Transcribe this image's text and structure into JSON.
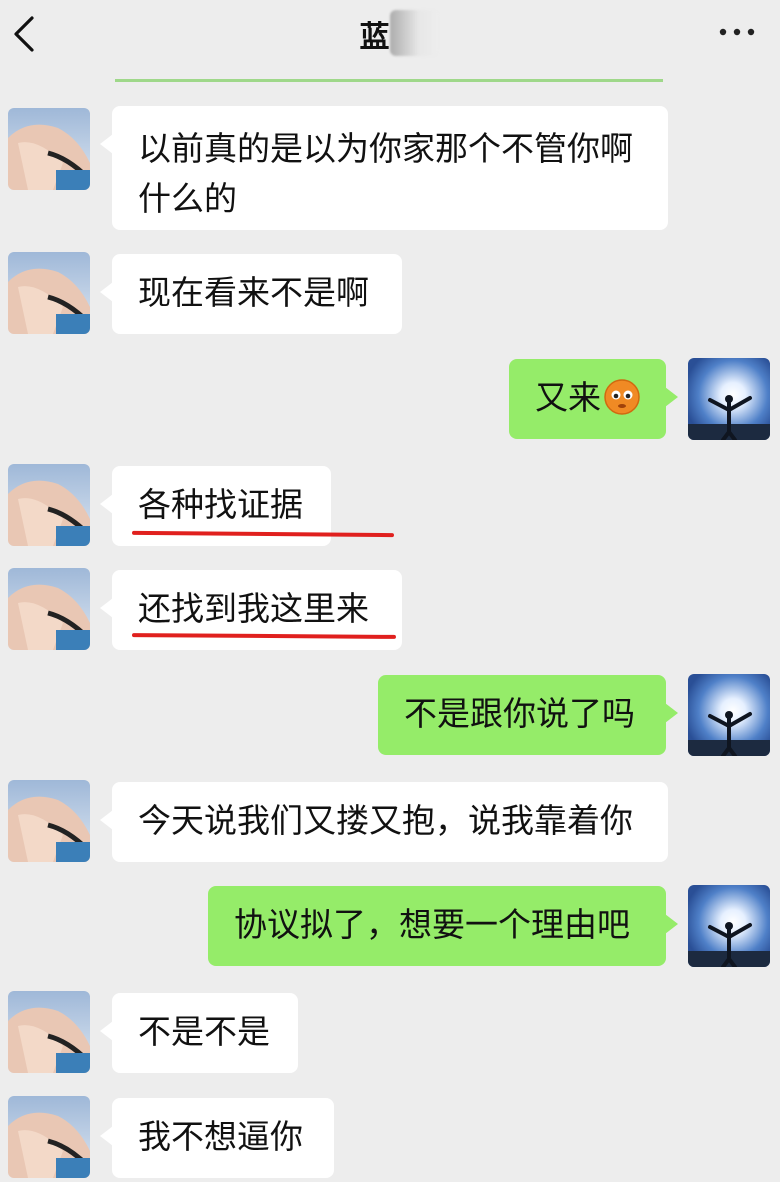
{
  "header": {
    "title": "蓝",
    "back_icon": "chevron-left-icon",
    "more_icon": "more-dots-icon"
  },
  "colors": {
    "background": "#ededed",
    "incoming_bubble": "#ffffff",
    "outgoing_bubble": "#95ec69",
    "highlight_underline": "#e0201e"
  },
  "messages": [
    {
      "side": "left",
      "text": "以前真的是以为你家那个不管你啊什么的"
    },
    {
      "side": "left",
      "text": "现在看来不是啊"
    },
    {
      "side": "right",
      "text": "又来",
      "emoji": "orange-face-emoji"
    },
    {
      "side": "left",
      "text": "各种找证据",
      "underlined": true
    },
    {
      "side": "left",
      "text": "还找到我这里来",
      "underlined": true
    },
    {
      "side": "right",
      "text": "不是跟你说了吗"
    },
    {
      "side": "left",
      "text": "今天说我们又搂又抱，说我靠着你"
    },
    {
      "side": "right",
      "text": "协议拟了，想要一个理由吧"
    },
    {
      "side": "left",
      "text": "不是不是"
    },
    {
      "side": "left",
      "text": "我不想逼你"
    }
  ]
}
